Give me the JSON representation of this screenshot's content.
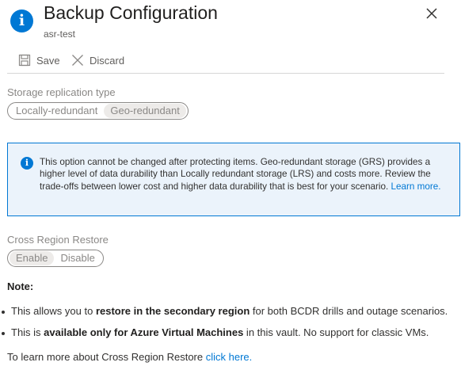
{
  "header": {
    "icon": "info-icon",
    "title": "Backup Configuration",
    "subtitle": "asr-test",
    "close_icon": "close-icon"
  },
  "toolbar": {
    "save_label": "Save",
    "discard_label": "Discard"
  },
  "storage": {
    "label": "Storage replication type",
    "options": [
      "Locally-redundant",
      "Geo-redundant"
    ],
    "selected": "Geo-redundant"
  },
  "info": {
    "text": "This option cannot be changed after protecting items.  Geo-redundant storage (GRS) provides a higher level of data durability than Locally redundant storage (LRS) and costs more. Review the trade-offs between lower cost and higher data durability that is best for your scenario. ",
    "link_text": "Learn more."
  },
  "cross_region": {
    "label": "Cross Region Restore",
    "options": [
      "Enable",
      "Disable"
    ],
    "selected": "Enable"
  },
  "note": {
    "title": "Note:",
    "bullets": [
      {
        "pre": "This allows you to ",
        "bold": "restore in the secondary region",
        "post": " for both BCDR drills and outage scenarios."
      },
      {
        "pre": "This is ",
        "bold": "available only for Azure Virtual Machines",
        "post": " in this vault. No support for classic VMs."
      }
    ],
    "learn_pre": "To learn more about Cross Region Restore ",
    "learn_link": "click here."
  },
  "colors": {
    "accent": "#0078d4",
    "info_bg": "#ebf3fb",
    "disabled_text": "#8a8886"
  }
}
